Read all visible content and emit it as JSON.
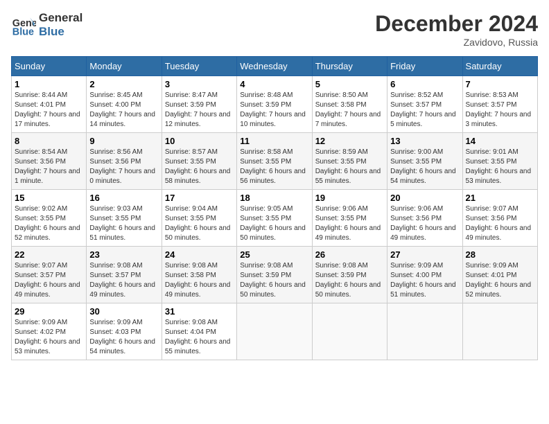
{
  "logo": {
    "line1": "General",
    "line2": "Blue"
  },
  "title": "December 2024",
  "subtitle": "Zavidovo, Russia",
  "days_of_week": [
    "Sunday",
    "Monday",
    "Tuesday",
    "Wednesday",
    "Thursday",
    "Friday",
    "Saturday"
  ],
  "weeks": [
    [
      {
        "day": 1,
        "sunrise": "Sunrise: 8:44 AM",
        "sunset": "Sunset: 4:01 PM",
        "daylight": "Daylight: 7 hours and 17 minutes."
      },
      {
        "day": 2,
        "sunrise": "Sunrise: 8:45 AM",
        "sunset": "Sunset: 4:00 PM",
        "daylight": "Daylight: 7 hours and 14 minutes."
      },
      {
        "day": 3,
        "sunrise": "Sunrise: 8:47 AM",
        "sunset": "Sunset: 3:59 PM",
        "daylight": "Daylight: 7 hours and 12 minutes."
      },
      {
        "day": 4,
        "sunrise": "Sunrise: 8:48 AM",
        "sunset": "Sunset: 3:59 PM",
        "daylight": "Daylight: 7 hours and 10 minutes."
      },
      {
        "day": 5,
        "sunrise": "Sunrise: 8:50 AM",
        "sunset": "Sunset: 3:58 PM",
        "daylight": "Daylight: 7 hours and 7 minutes."
      },
      {
        "day": 6,
        "sunrise": "Sunrise: 8:52 AM",
        "sunset": "Sunset: 3:57 PM",
        "daylight": "Daylight: 7 hours and 5 minutes."
      },
      {
        "day": 7,
        "sunrise": "Sunrise: 8:53 AM",
        "sunset": "Sunset: 3:57 PM",
        "daylight": "Daylight: 7 hours and 3 minutes."
      }
    ],
    [
      {
        "day": 8,
        "sunrise": "Sunrise: 8:54 AM",
        "sunset": "Sunset: 3:56 PM",
        "daylight": "Daylight: 7 hours and 1 minute."
      },
      {
        "day": 9,
        "sunrise": "Sunrise: 8:56 AM",
        "sunset": "Sunset: 3:56 PM",
        "daylight": "Daylight: 7 hours and 0 minutes."
      },
      {
        "day": 10,
        "sunrise": "Sunrise: 8:57 AM",
        "sunset": "Sunset: 3:55 PM",
        "daylight": "Daylight: 6 hours and 58 minutes."
      },
      {
        "day": 11,
        "sunrise": "Sunrise: 8:58 AM",
        "sunset": "Sunset: 3:55 PM",
        "daylight": "Daylight: 6 hours and 56 minutes."
      },
      {
        "day": 12,
        "sunrise": "Sunrise: 8:59 AM",
        "sunset": "Sunset: 3:55 PM",
        "daylight": "Daylight: 6 hours and 55 minutes."
      },
      {
        "day": 13,
        "sunrise": "Sunrise: 9:00 AM",
        "sunset": "Sunset: 3:55 PM",
        "daylight": "Daylight: 6 hours and 54 minutes."
      },
      {
        "day": 14,
        "sunrise": "Sunrise: 9:01 AM",
        "sunset": "Sunset: 3:55 PM",
        "daylight": "Daylight: 6 hours and 53 minutes."
      }
    ],
    [
      {
        "day": 15,
        "sunrise": "Sunrise: 9:02 AM",
        "sunset": "Sunset: 3:55 PM",
        "daylight": "Daylight: 6 hours and 52 minutes."
      },
      {
        "day": 16,
        "sunrise": "Sunrise: 9:03 AM",
        "sunset": "Sunset: 3:55 PM",
        "daylight": "Daylight: 6 hours and 51 minutes."
      },
      {
        "day": 17,
        "sunrise": "Sunrise: 9:04 AM",
        "sunset": "Sunset: 3:55 PM",
        "daylight": "Daylight: 6 hours and 50 minutes."
      },
      {
        "day": 18,
        "sunrise": "Sunrise: 9:05 AM",
        "sunset": "Sunset: 3:55 PM",
        "daylight": "Daylight: 6 hours and 50 minutes."
      },
      {
        "day": 19,
        "sunrise": "Sunrise: 9:06 AM",
        "sunset": "Sunset: 3:55 PM",
        "daylight": "Daylight: 6 hours and 49 minutes."
      },
      {
        "day": 20,
        "sunrise": "Sunrise: 9:06 AM",
        "sunset": "Sunset: 3:56 PM",
        "daylight": "Daylight: 6 hours and 49 minutes."
      },
      {
        "day": 21,
        "sunrise": "Sunrise: 9:07 AM",
        "sunset": "Sunset: 3:56 PM",
        "daylight": "Daylight: 6 hours and 49 minutes."
      }
    ],
    [
      {
        "day": 22,
        "sunrise": "Sunrise: 9:07 AM",
        "sunset": "Sunset: 3:57 PM",
        "daylight": "Daylight: 6 hours and 49 minutes."
      },
      {
        "day": 23,
        "sunrise": "Sunrise: 9:08 AM",
        "sunset": "Sunset: 3:57 PM",
        "daylight": "Daylight: 6 hours and 49 minutes."
      },
      {
        "day": 24,
        "sunrise": "Sunrise: 9:08 AM",
        "sunset": "Sunset: 3:58 PM",
        "daylight": "Daylight: 6 hours and 49 minutes."
      },
      {
        "day": 25,
        "sunrise": "Sunrise: 9:08 AM",
        "sunset": "Sunset: 3:59 PM",
        "daylight": "Daylight: 6 hours and 50 minutes."
      },
      {
        "day": 26,
        "sunrise": "Sunrise: 9:08 AM",
        "sunset": "Sunset: 3:59 PM",
        "daylight": "Daylight: 6 hours and 50 minutes."
      },
      {
        "day": 27,
        "sunrise": "Sunrise: 9:09 AM",
        "sunset": "Sunset: 4:00 PM",
        "daylight": "Daylight: 6 hours and 51 minutes."
      },
      {
        "day": 28,
        "sunrise": "Sunrise: 9:09 AM",
        "sunset": "Sunset: 4:01 PM",
        "daylight": "Daylight: 6 hours and 52 minutes."
      }
    ],
    [
      {
        "day": 29,
        "sunrise": "Sunrise: 9:09 AM",
        "sunset": "Sunset: 4:02 PM",
        "daylight": "Daylight: 6 hours and 53 minutes."
      },
      {
        "day": 30,
        "sunrise": "Sunrise: 9:09 AM",
        "sunset": "Sunset: 4:03 PM",
        "daylight": "Daylight: 6 hours and 54 minutes."
      },
      {
        "day": 31,
        "sunrise": "Sunrise: 9:08 AM",
        "sunset": "Sunset: 4:04 PM",
        "daylight": "Daylight: 6 hours and 55 minutes."
      },
      null,
      null,
      null,
      null
    ]
  ]
}
